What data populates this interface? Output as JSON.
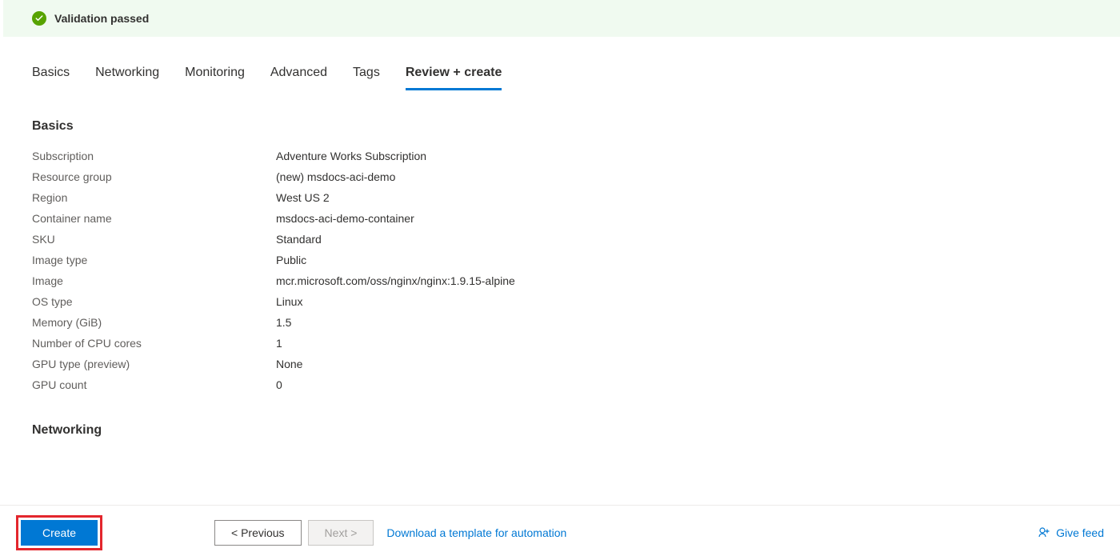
{
  "validation": {
    "message": "Validation passed"
  },
  "tabs": [
    {
      "label": "Basics",
      "active": false
    },
    {
      "label": "Networking",
      "active": false
    },
    {
      "label": "Monitoring",
      "active": false
    },
    {
      "label": "Advanced",
      "active": false
    },
    {
      "label": "Tags",
      "active": false
    },
    {
      "label": "Review + create",
      "active": true
    }
  ],
  "sections": {
    "basics": {
      "heading": "Basics",
      "rows": [
        {
          "label": "Subscription",
          "value": "Adventure Works Subscription"
        },
        {
          "label": "Resource group",
          "value": "(new) msdocs-aci-demo"
        },
        {
          "label": "Region",
          "value": "West US 2"
        },
        {
          "label": "Container name",
          "value": "msdocs-aci-demo-container"
        },
        {
          "label": "SKU",
          "value": "Standard"
        },
        {
          "label": "Image type",
          "value": "Public"
        },
        {
          "label": "Image",
          "value": "mcr.microsoft.com/oss/nginx/nginx:1.9.15-alpine"
        },
        {
          "label": "OS type",
          "value": "Linux"
        },
        {
          "label": "Memory (GiB)",
          "value": "1.5"
        },
        {
          "label": "Number of CPU cores",
          "value": "1"
        },
        {
          "label": "GPU type (preview)",
          "value": "None"
        },
        {
          "label": "GPU count",
          "value": "0"
        }
      ]
    },
    "networking": {
      "heading": "Networking"
    }
  },
  "footer": {
    "create": "Create",
    "previous": "< Previous",
    "next": "Next >",
    "download": "Download a template for automation",
    "feedback": "Give feed"
  }
}
